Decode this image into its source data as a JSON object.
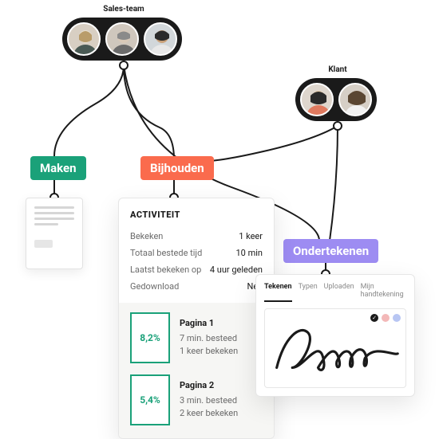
{
  "groups": {
    "sales": {
      "label": "Sales-team"
    },
    "client": {
      "label": "Klant"
    }
  },
  "tags": {
    "make": "Maken",
    "track": "Bijhouden",
    "sign": "Ondertekenen"
  },
  "activity": {
    "title": "ACTIVITEIT",
    "rows": [
      {
        "k": "Bekeken",
        "v": "1 keer"
      },
      {
        "k": "Totaal bestede tijd",
        "v": "10 min"
      },
      {
        "k": "Laatst bekeken op",
        "v": "4 uur geleden"
      },
      {
        "k": "Gedownload",
        "v": "Nee"
      }
    ],
    "pages": [
      {
        "pct": "8,2%",
        "title": "Pagina 1",
        "l1": "7 min. besteed",
        "l2": "1 keer bekeken"
      },
      {
        "pct": "5,4%",
        "title": "Pagina 2",
        "l1": "3 min. besteed",
        "l2": "2 keer bekeken"
      }
    ]
  },
  "signature": {
    "tabs": [
      "Tekenen",
      "Typen",
      "Uploaden",
      "Mijn handtekening"
    ],
    "active_tab": 0,
    "colors": [
      "black",
      "pink",
      "blue"
    ]
  }
}
